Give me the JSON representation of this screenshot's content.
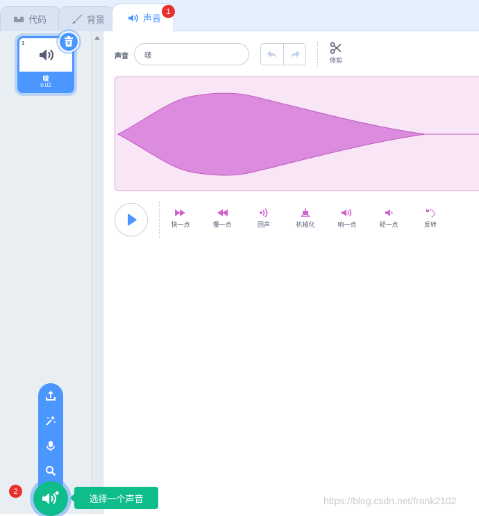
{
  "tabs": [
    {
      "label": "代码",
      "icon": "code-icon"
    },
    {
      "label": "背景",
      "icon": "brush-icon"
    },
    {
      "label": "声音",
      "icon": "speaker-icon"
    }
  ],
  "annotations": {
    "tab_badge": "1",
    "add_badge": "2"
  },
  "sound_list": [
    {
      "number": "1",
      "name": "啵",
      "duration": "0.02"
    }
  ],
  "editor": {
    "sound_label": "声音",
    "sound_name": "啵",
    "trim_label": "修剪"
  },
  "effects": [
    {
      "label": "快一点",
      "icon": "faster-icon"
    },
    {
      "label": "慢一点",
      "icon": "slower-icon"
    },
    {
      "label": "回声",
      "icon": "echo-icon"
    },
    {
      "label": "机械化",
      "icon": "robot-icon"
    },
    {
      "label": "响一点",
      "icon": "louder-icon"
    },
    {
      "label": "轻一点",
      "icon": "softer-icon"
    },
    {
      "label": "反转",
      "icon": "reverse-icon"
    }
  ],
  "add_menu": {
    "items": [
      "upload-icon",
      "surprise-icon",
      "record-icon",
      "search-icon"
    ],
    "tooltip": "选择一个声音"
  },
  "watermark": "https://blog.csdn.net/frank2102",
  "colors": {
    "accent": "#4c97ff",
    "wave": "#dc8cde",
    "effect": "#cf63cf",
    "add": "#0fbd8c"
  }
}
